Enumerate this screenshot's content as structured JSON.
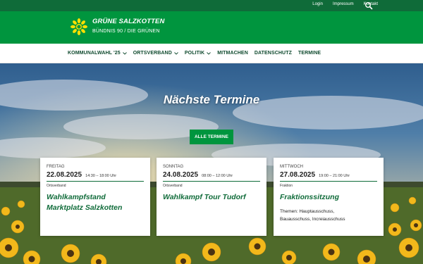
{
  "topbar": {
    "links": [
      "Login",
      "Impressum",
      "Kontakt"
    ],
    "search_icon": "search-icon"
  },
  "brand": {
    "title": "GRÜNE SALZKOTTEN",
    "subtitle": "BÜNDNIS 90 / DIE GRÜNEN",
    "logo_icon": "sunflower-logo"
  },
  "nav": [
    {
      "label": "KOMMUNALWAHL '25",
      "dropdown": true
    },
    {
      "label": "ORTSVERBAND",
      "dropdown": true
    },
    {
      "label": "POLITIK",
      "dropdown": true
    },
    {
      "label": "MITMACHEN",
      "dropdown": false
    },
    {
      "label": "DATENSCHUTZ",
      "dropdown": false
    },
    {
      "label": "TERMINE",
      "dropdown": false
    }
  ],
  "hero": {
    "title": "Nächste Termine",
    "button_label": "ALLE TERMINE"
  },
  "events": [
    {
      "weekday": "FREITAG",
      "date": "22.08.2025",
      "time": "14:30 – 18:00 Uhr",
      "organizer": "Ortsverband",
      "title": "Wahlkampfstand Marktplatz Salzkotten",
      "description": ""
    },
    {
      "weekday": "SONNTAG",
      "date": "24.08.2025",
      "time": "08:00 – 12:00 Uhr",
      "organizer": "Ortsverband",
      "title": "Wahlkampf Tour Tudorf",
      "description": ""
    },
    {
      "weekday": "MITTWOCH",
      "date": "27.08.2025",
      "time": "19:00 – 21:00 Uhr",
      "organizer": "Fraktion",
      "title": "Fraktionssitzung",
      "description": "Themen: Hauptausschuss, Bauausschuss, Increiausschuss"
    }
  ],
  "colors": {
    "topbar": "#0f6b39",
    "brand": "#00953e",
    "accent": "#0f6b39"
  }
}
